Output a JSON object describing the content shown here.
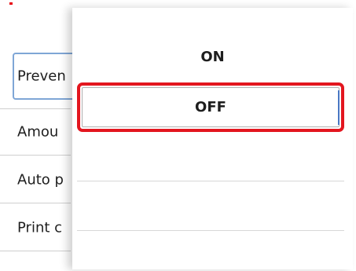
{
  "settings_list": {
    "items": [
      {
        "label": "Preven"
      },
      {
        "label": "Amou"
      },
      {
        "label": "Auto p"
      },
      {
        "label": "Print c"
      }
    ]
  },
  "dialog": {
    "options": [
      {
        "label": "ON"
      },
      {
        "label": "OFF"
      }
    ],
    "selected_index": 1
  },
  "colors": {
    "highlight_border": "#e3161f",
    "focus_border": "#7fa6d6"
  }
}
